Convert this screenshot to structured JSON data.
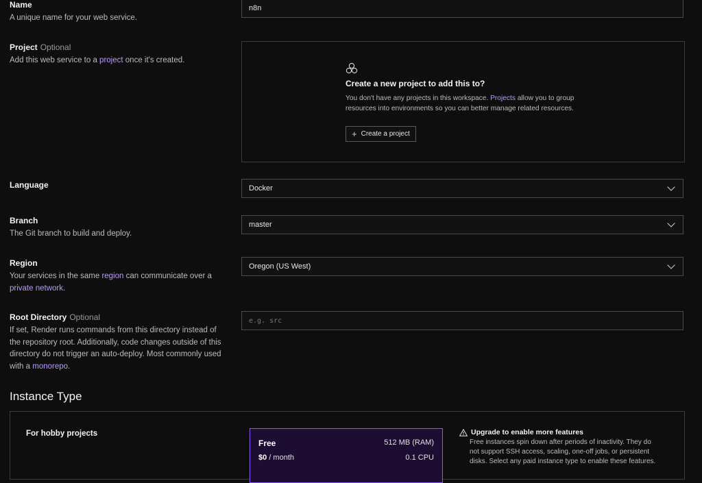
{
  "name": {
    "label": "Name",
    "description": "A unique name for your web service.",
    "value": "n8n"
  },
  "project": {
    "label": "Project",
    "optional": "Optional",
    "desc_pre": "Add this web service to a ",
    "desc_link": "project",
    "desc_post": " once it's created.",
    "empty_title": "Create a new project to add this to?",
    "empty_pre": "You don't have any projects in this workspace. ",
    "empty_link": "Projects",
    "empty_post": " allow you to group resources into environments so you can better manage related resources.",
    "create_button": "Create a project"
  },
  "language": {
    "label": "Language",
    "value": "Docker"
  },
  "branch": {
    "label": "Branch",
    "description": "The Git branch to build and deploy.",
    "value": "master"
  },
  "region": {
    "label": "Region",
    "desc_pre": "Your services in the same ",
    "desc_link1": "region",
    "desc_mid": " can communicate over a ",
    "desc_link2": "private network",
    "desc_post": ".",
    "value": "Oregon (US West)"
  },
  "root_directory": {
    "label": "Root Directory",
    "optional": "Optional",
    "desc_pre": "If set, Render runs commands from this directory instead of the repository root. Additionally, code changes outside of this directory do not trigger an auto-deploy. Most commonly used with a ",
    "desc_link": "monorepo",
    "desc_post": ".",
    "placeholder": "e.g. src"
  },
  "instance_type": {
    "title": "Instance Type",
    "hobby_label": "For hobby projects",
    "free": {
      "name": "Free",
      "ram": "512 MB (RAM)",
      "price": "$0",
      "period": " / month",
      "cpu": "0.1 CPU"
    },
    "upgrade": {
      "title": "Upgrade to enable more features",
      "description": "Free instances spin down after periods of inactivity. They do not support SSH access, scaling, one-off jobs, or persistent disks. Select any paid instance type to enable these features."
    }
  },
  "colors": {
    "background": "#0e0e0e",
    "link": "#b79cf7",
    "accent": "#8a5cf6",
    "selected_card": "#1e0d33"
  },
  "icons": [
    "projects-icon",
    "plus-icon",
    "chevron-down-icon",
    "warning-icon"
  ]
}
